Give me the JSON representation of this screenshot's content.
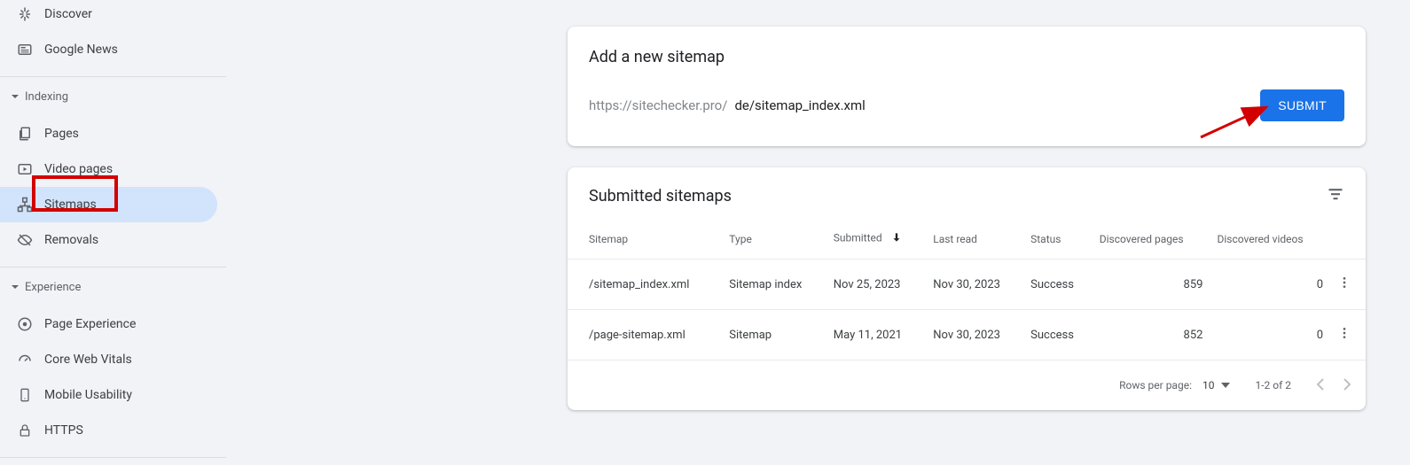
{
  "sidebar": {
    "top_items": [
      {
        "label": "Discover"
      },
      {
        "label": "Google News"
      }
    ],
    "groups": [
      {
        "label": "Indexing",
        "items": [
          {
            "label": "Pages",
            "icon": "pages"
          },
          {
            "label": "Video pages",
            "icon": "video"
          },
          {
            "label": "Sitemaps",
            "icon": "sitemaps",
            "active": true,
            "highlighted": true
          },
          {
            "label": "Removals",
            "icon": "removals"
          }
        ]
      },
      {
        "label": "Experience",
        "items": [
          {
            "label": "Page Experience",
            "icon": "page-exp"
          },
          {
            "label": "Core Web Vitals",
            "icon": "speed"
          },
          {
            "label": "Mobile Usability",
            "icon": "mobile"
          },
          {
            "label": "HTTPS",
            "icon": "lock"
          }
        ]
      }
    ]
  },
  "add_sitemap": {
    "title": "Add a new sitemap",
    "prefix": "https://sitechecker.pro/",
    "value": "de/sitemap_index.xml",
    "submit_label": "SUBMIT"
  },
  "submitted": {
    "title": "Submitted sitemaps",
    "columns": {
      "sitemap": "Sitemap",
      "type": "Type",
      "submitted": "Submitted",
      "last_read": "Last read",
      "status": "Status",
      "discovered_pages": "Discovered pages",
      "discovered_videos": "Discovered videos"
    },
    "rows": [
      {
        "sitemap": "/sitemap_index.xml",
        "type": "Sitemap index",
        "submitted": "Nov 25, 2023",
        "last_read": "Nov 30, 2023",
        "status": "Success",
        "discovered_pages": "859",
        "discovered_videos": "0"
      },
      {
        "sitemap": "/page-sitemap.xml",
        "type": "Sitemap",
        "submitted": "May 11, 2021",
        "last_read": "Nov 30, 2023",
        "status": "Success",
        "discovered_pages": "852",
        "discovered_videos": "0"
      }
    ],
    "footer": {
      "rows_per_page_label": "Rows per page:",
      "rows_per_page_value": "10",
      "range": "1-2 of 2"
    }
  }
}
